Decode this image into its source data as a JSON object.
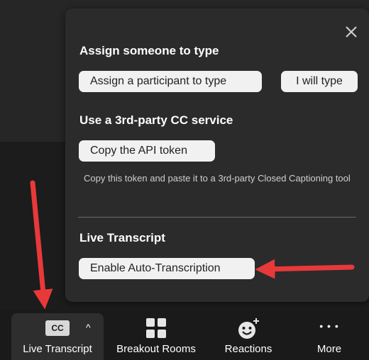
{
  "panel": {
    "close_label": "×",
    "assign_section": {
      "title": "Assign someone to type",
      "assign_participant_label": "Assign a participant to type",
      "i_will_type_label": "I will type"
    },
    "third_party_section": {
      "title": "Use a 3rd-party CC service",
      "copy_token_label": "Copy the API token",
      "helper_text": "Copy this token and paste it to a 3rd-party Closed Captioning tool"
    },
    "live_transcript_section": {
      "title": "Live Transcript",
      "enable_auto_label": "Enable Auto-Transcription"
    }
  },
  "toolbar": {
    "live_transcript": {
      "label": "Live Transcript",
      "icon_text": "CC",
      "caret": "^"
    },
    "breakout_rooms": {
      "label": "Breakout Rooms"
    },
    "reactions": {
      "label": "Reactions"
    },
    "more": {
      "label": "More",
      "icon_text": "• • •"
    }
  },
  "colors": {
    "annotation_arrow": "#e8393a",
    "panel_bg": "#2b2b2b",
    "button_bg": "#f1f1f1"
  }
}
